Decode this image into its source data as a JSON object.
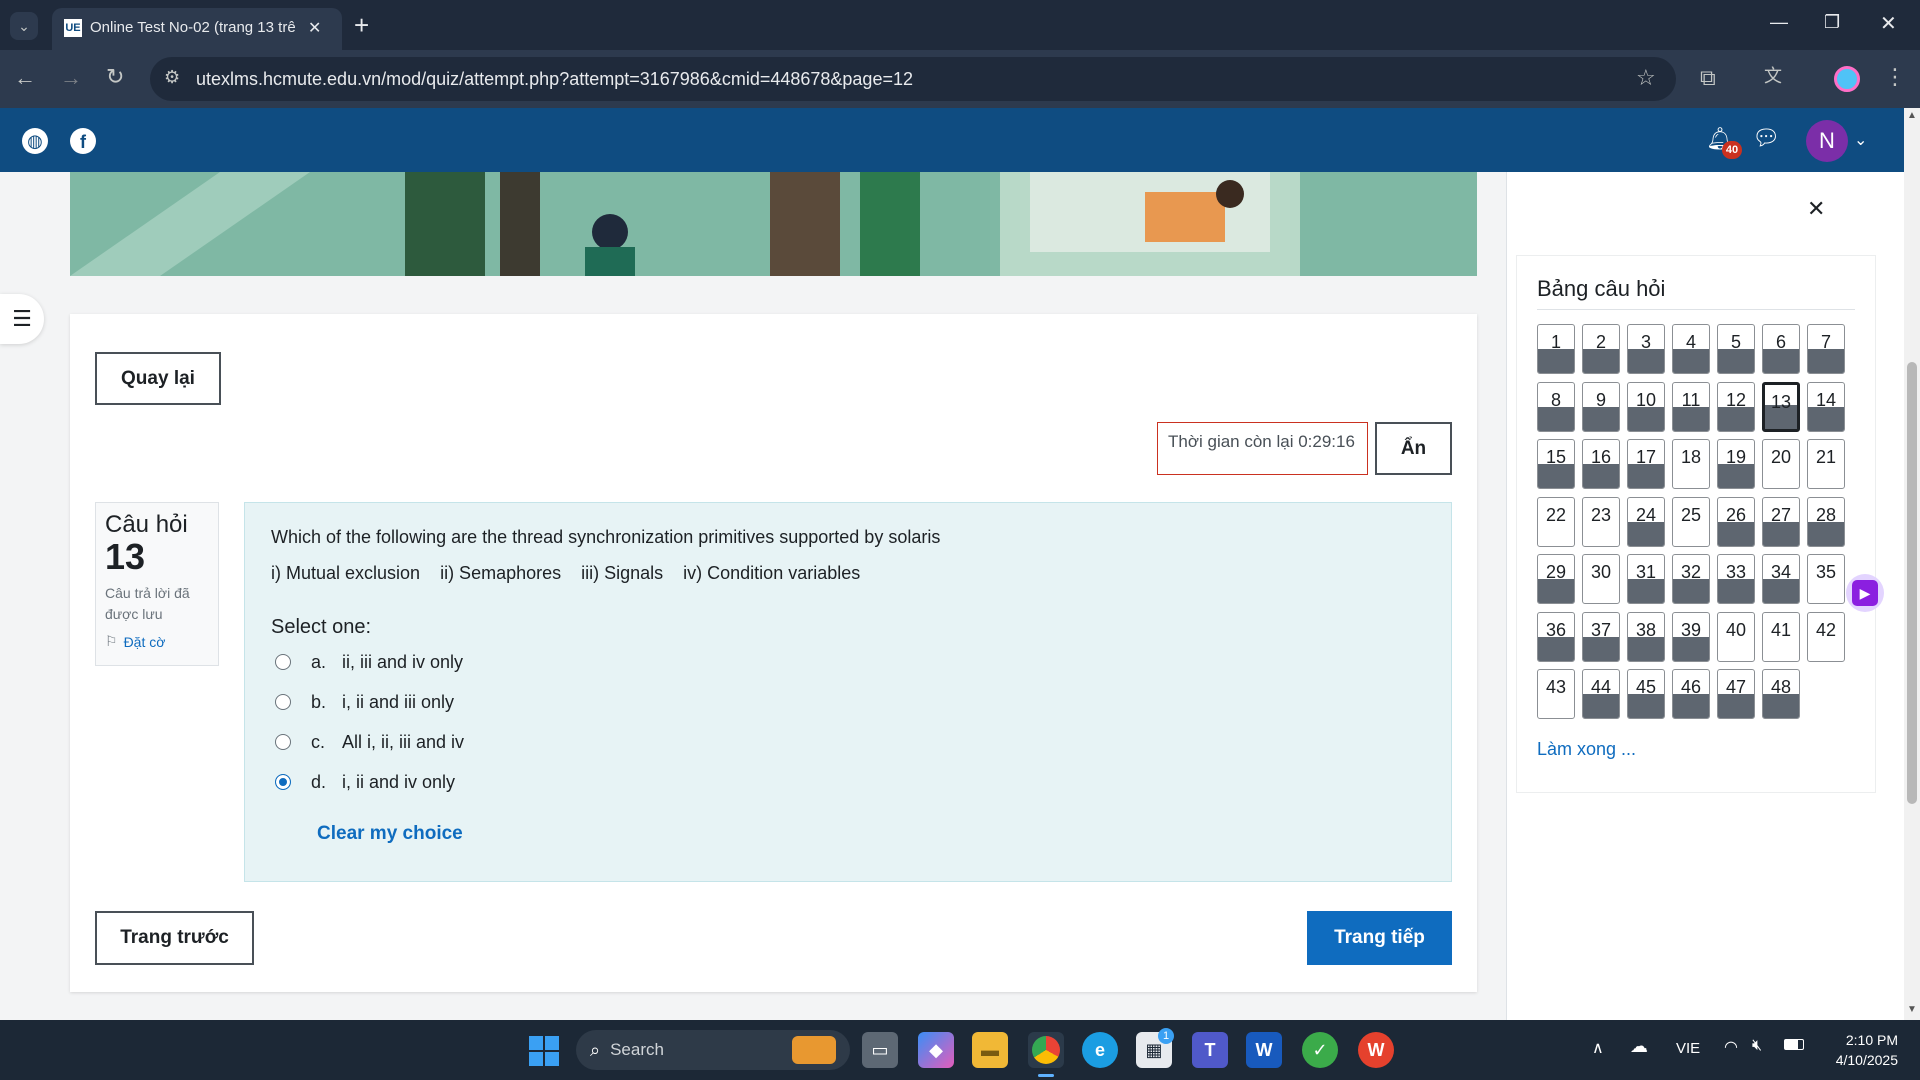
{
  "browser": {
    "tab_title": "Online Test No-02 (trang 13 trê",
    "tab_close": "✕",
    "new_tab": "+",
    "url": "utexlms.hcmute.edu.vn/mod/quiz/attempt.php?attempt=3167986&cmid=448678&page=12",
    "window_controls": [
      "—",
      "❐",
      "✕"
    ]
  },
  "header": {
    "notification_count": "40",
    "avatar_letter": "N"
  },
  "quiz": {
    "back_button": "Quay lại",
    "timer_label": "Thời gian còn lại 0:29:16",
    "hide_button": "Ẩn",
    "question_label": "Câu hỏi",
    "question_number": "13",
    "question_status": "Câu trả lời đã được lưu",
    "flag_label": "Đặt cờ",
    "question_text": "Which of the following are the thread synchronization primitives supported by solaris",
    "question_items": "i) Mutual exclusion    ii) Semaphores    iii) Signals    iv) Condition variables",
    "select_one": "Select one:",
    "options": [
      {
        "letter": "a.",
        "text": "ii, iii and iv only",
        "selected": false
      },
      {
        "letter": "b.",
        "text": "i, ii and iii only",
        "selected": false
      },
      {
        "letter": "c.",
        "text": "All i, ii, iii and iv",
        "selected": false
      },
      {
        "letter": "d.",
        "text": "i, ii and iv only",
        "selected": true
      }
    ],
    "clear_choice": "Clear my choice",
    "prev_page": "Trang trước",
    "next_page": "Trang tiếp"
  },
  "navigation": {
    "close_icon": "✕",
    "title": "Bảng câu hỏi",
    "questions": [
      {
        "n": "1",
        "answered": true
      },
      {
        "n": "2",
        "answered": true
      },
      {
        "n": "3",
        "answered": true
      },
      {
        "n": "4",
        "answered": true
      },
      {
        "n": "5",
        "answered": true
      },
      {
        "n": "6",
        "answered": true
      },
      {
        "n": "7",
        "answered": true
      },
      {
        "n": "8",
        "answered": true
      },
      {
        "n": "9",
        "answered": true
      },
      {
        "n": "10",
        "answered": true
      },
      {
        "n": "11",
        "answered": true
      },
      {
        "n": "12",
        "answered": true
      },
      {
        "n": "13",
        "answered": true,
        "current": true
      },
      {
        "n": "14",
        "answered": true
      },
      {
        "n": "15",
        "answered": true
      },
      {
        "n": "16",
        "answered": true
      },
      {
        "n": "17",
        "answered": true
      },
      {
        "n": "18",
        "answered": false
      },
      {
        "n": "19",
        "answered": true
      },
      {
        "n": "20",
        "answered": false
      },
      {
        "n": "21",
        "answered": false
      },
      {
        "n": "22",
        "answered": false
      },
      {
        "n": "23",
        "answered": false
      },
      {
        "n": "24",
        "answered": true
      },
      {
        "n": "25",
        "answered": false
      },
      {
        "n": "26",
        "answered": true
      },
      {
        "n": "27",
        "answered": true
      },
      {
        "n": "28",
        "answered": true
      },
      {
        "n": "29",
        "answered": true
      },
      {
        "n": "30",
        "answered": false
      },
      {
        "n": "31",
        "answered": true
      },
      {
        "n": "32",
        "answered": true
      },
      {
        "n": "33",
        "answered": true
      },
      {
        "n": "34",
        "answered": true
      },
      {
        "n": "35",
        "answered": false
      },
      {
        "n": "36",
        "answered": true
      },
      {
        "n": "37",
        "answered": true
      },
      {
        "n": "38",
        "answered": true
      },
      {
        "n": "39",
        "answered": true
      },
      {
        "n": "40",
        "answered": false
      },
      {
        "n": "41",
        "answered": false
      },
      {
        "n": "42",
        "answered": false
      },
      {
        "n": "43",
        "answered": false
      },
      {
        "n": "44",
        "answered": true
      },
      {
        "n": "45",
        "answered": true
      },
      {
        "n": "46",
        "answered": true
      },
      {
        "n": "47",
        "answered": true
      },
      {
        "n": "48",
        "answered": true
      }
    ],
    "finish_link": "Làm xong ..."
  },
  "taskbar": {
    "search_placeholder": "Search",
    "teams_badge": "1",
    "language": "VIE",
    "time": "2:10 PM",
    "date": "4/10/2025"
  },
  "colors": {
    "moodle_blue": "#0f4c81",
    "primary": "#0f6cbf",
    "timer_border": "#ca3120",
    "answered_fill": "#5e6670"
  }
}
